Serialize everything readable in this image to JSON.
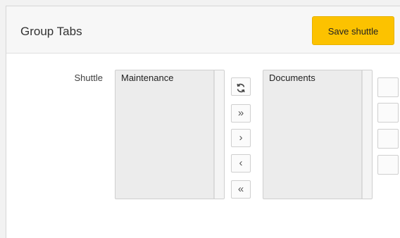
{
  "header": {
    "title": "Group Tabs",
    "save_label": "Save shuttle"
  },
  "shuttle": {
    "label": "Shuttle",
    "left_list": {
      "options": [
        "Maintenance"
      ]
    },
    "right_list": {
      "options": [
        "Documents"
      ]
    },
    "controls": [
      {
        "name": "reset",
        "icon": "reset-icon",
        "glyph": ""
      },
      {
        "name": "move-all",
        "icon": "double-chevron-right-icon",
        "glyph": "»"
      },
      {
        "name": "move",
        "icon": "chevron-right-icon",
        "glyph": "›"
      },
      {
        "name": "remove",
        "icon": "chevron-left-icon",
        "glyph": "‹"
      },
      {
        "name": "remove-all",
        "icon": "double-chevron-left-icon",
        "glyph": "«"
      }
    ]
  },
  "colors": {
    "accent": "#fcc200",
    "header_bg": "#f7f7f7",
    "list_bg": "#ececec"
  }
}
